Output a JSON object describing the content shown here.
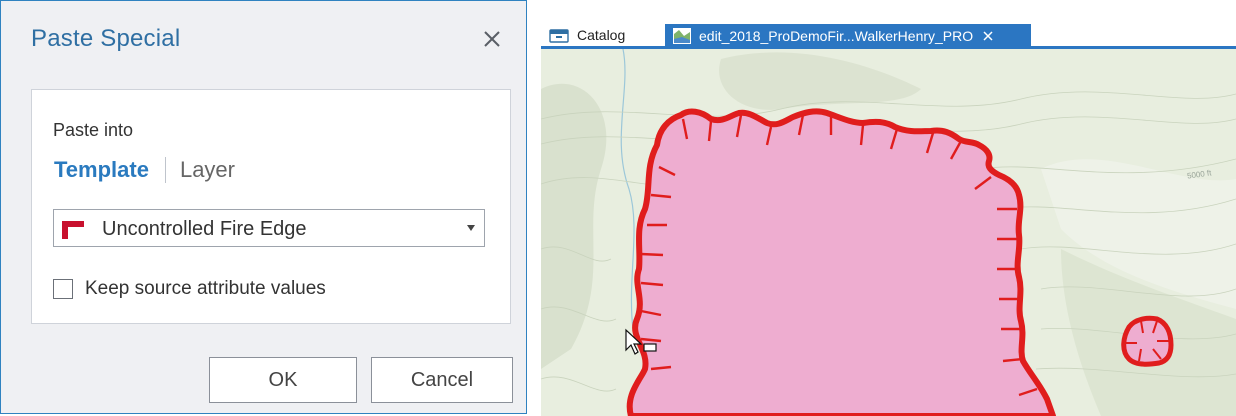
{
  "dialog": {
    "title": "Paste Special",
    "paste_into_label": "Paste into",
    "tabs": {
      "template": "Template",
      "layer": "Layer",
      "active": "template"
    },
    "template_select": {
      "value": "Uncontrolled Fire Edge",
      "icon": "red-flag-icon"
    },
    "keep_source": {
      "label": "Keep source attribute values",
      "checked": false
    },
    "buttons": {
      "ok": "OK",
      "cancel": "Cancel"
    }
  },
  "map": {
    "tabs": [
      {
        "label": "Catalog",
        "icon": "catalog-icon",
        "active": false
      },
      {
        "label": "edit_2018_ProDemoFir...WalkerHenry_PRO",
        "icon": "map-icon",
        "active": true,
        "closable": true
      }
    ],
    "contour_label": "5000 ft",
    "features": {
      "line_color": "#e01d1d",
      "fill_color": "#eeadd0"
    }
  },
  "colors": {
    "accent": "#2b76c2",
    "dialog_title": "#2f6fa3",
    "dialog_bg": "#eff0f3",
    "map_bg": "#e6eddc"
  }
}
